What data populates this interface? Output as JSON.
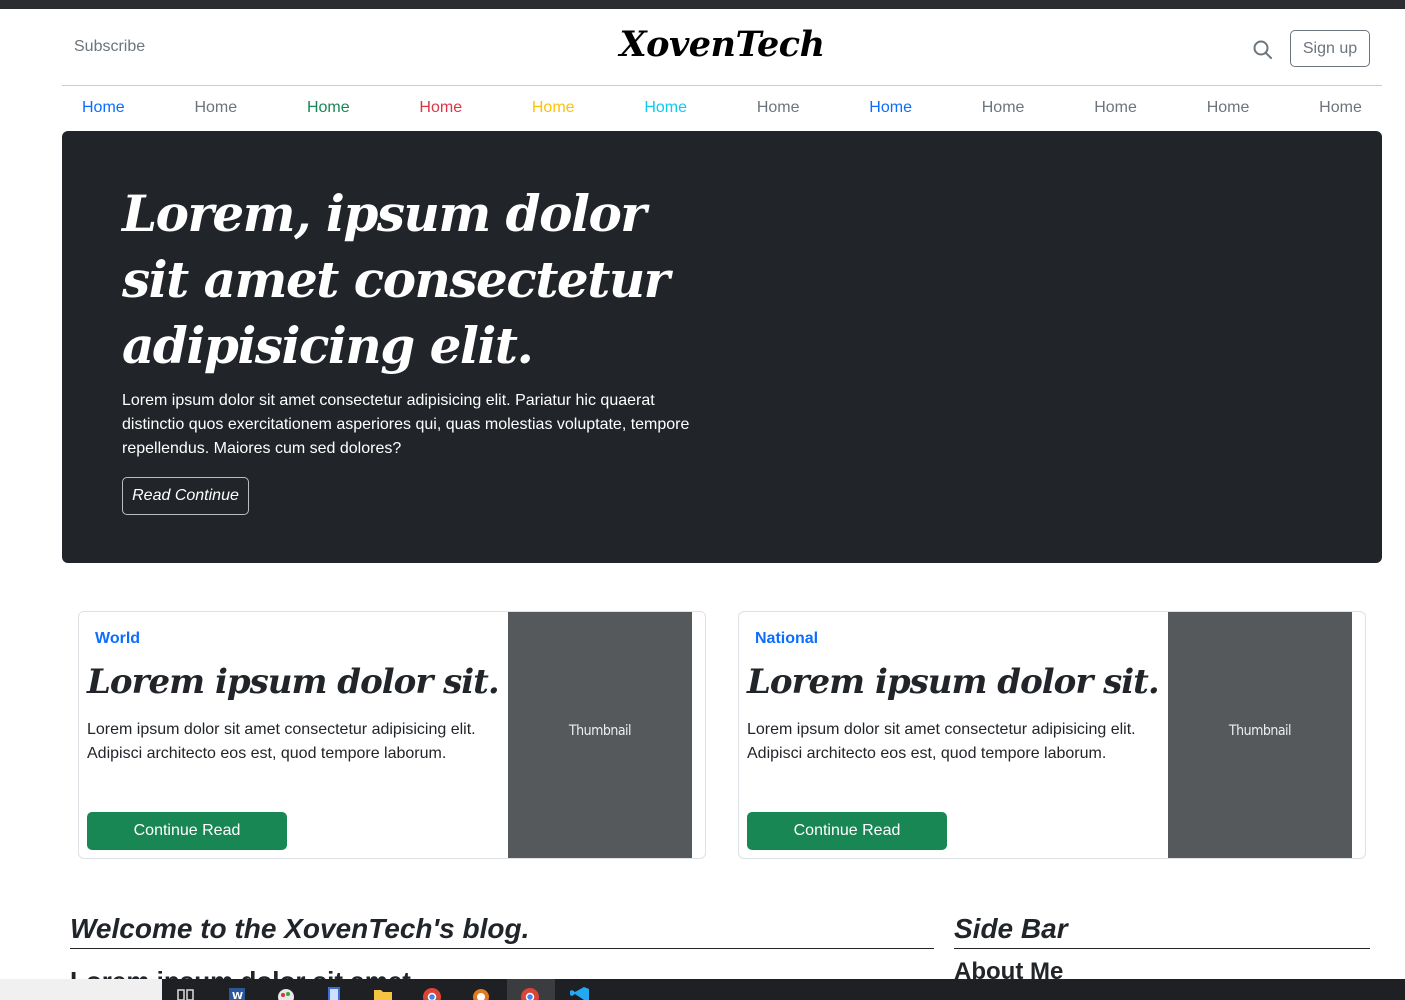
{
  "header": {
    "subscribe_label": "Subscribe",
    "brand": "XovenTech",
    "signup_label": "Sign up"
  },
  "nav": {
    "items": [
      {
        "label": "Home",
        "color": "#0d6efd"
      },
      {
        "label": "Home",
        "color": "#6c757d"
      },
      {
        "label": "Home",
        "color": "#198754"
      },
      {
        "label": "Home",
        "color": "#dc3545"
      },
      {
        "label": "Home",
        "color": "#ffc107"
      },
      {
        "label": "Home",
        "color": "#0dcaf0"
      },
      {
        "label": "Home",
        "color": "#6c757d"
      },
      {
        "label": "Home",
        "color": "#0d6efd"
      },
      {
        "label": "Home",
        "color": "#6c757d"
      },
      {
        "label": "Home",
        "color": "#6c757d"
      },
      {
        "label": "Home",
        "color": "#6c757d"
      },
      {
        "label": "Home",
        "color": "#6c757d"
      }
    ]
  },
  "hero": {
    "title": "Lorem, ipsum dolor sit amet consectetur adipisicing elit.",
    "text": "Lorem ipsum dolor sit amet consectetur adipisicing elit. Pariatur hic quaerat distinctio quos exercitationem asperiores qui, quas molestias voluptate, tempore repellendus. Maiores cum sed dolores?",
    "button_label": "Read Continue"
  },
  "cards": [
    {
      "category": "World",
      "title": "Lorem ipsum dolor sit.",
      "text": "Lorem ipsum dolor sit amet consectetur adipisicing elit. Adipisci architecto eos est, quod tempore laborum.",
      "button_label": "Continue Read",
      "thumbnail_label": "Thumbnail"
    },
    {
      "category": "National",
      "title": "Lorem ipsum dolor sit.",
      "text": "Lorem ipsum dolor sit amet consectetur adipisicing elit. Adipisci architecto eos est, quod tempore laborum.",
      "button_label": "Continue Read",
      "thumbnail_label": "Thumbnail"
    }
  ],
  "blog": {
    "heading": "Welcome to the XovenTech's blog.",
    "partial_subheading": "Lorem ipsum dolor sit amet"
  },
  "sidebar": {
    "heading": "Side Bar",
    "about_label": "About Me"
  },
  "colors": {
    "hero_bg": "#212529",
    "button_green": "#198754",
    "link_blue": "#0d6efd",
    "thumbnail_bg": "#55595c"
  },
  "taskbar": {
    "icons": [
      "task-view-icon",
      "word-icon",
      "paint-icon",
      "notepad-icon",
      "folder-icon",
      "chrome-icon",
      "settings-icon",
      "chrome-active-icon",
      "vscode-icon"
    ]
  }
}
